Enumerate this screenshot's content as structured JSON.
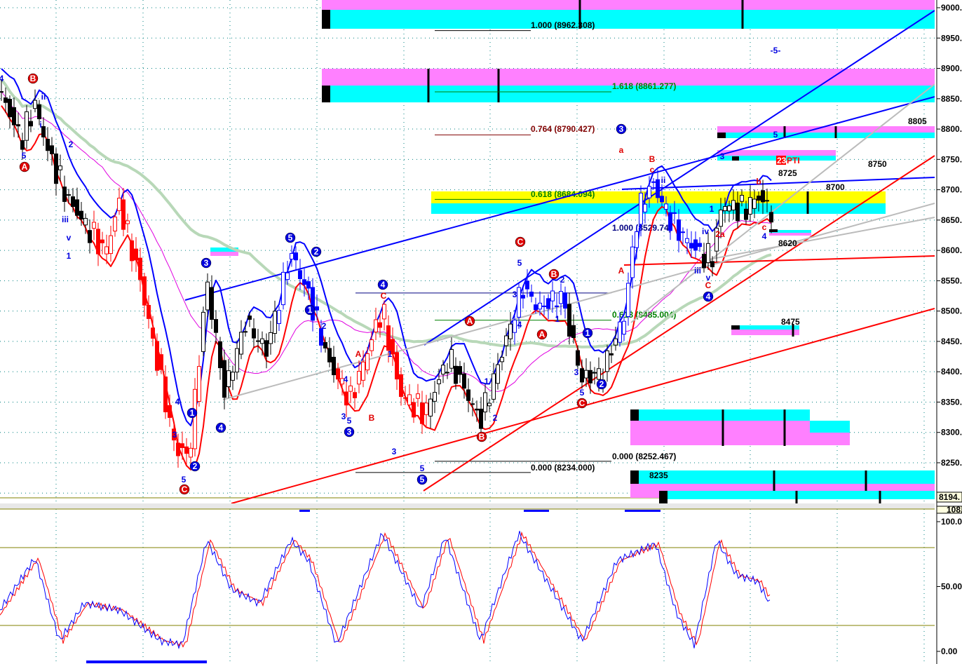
{
  "chart_data": {
    "type": "candlestick",
    "title": "",
    "price_axis": {
      "ticks": [
        "9000.",
        "8950.",
        "8900.",
        "8850.",
        "8800.",
        "8750.",
        "8700.",
        "8650.",
        "8600.",
        "8550.",
        "8500.",
        "8450.",
        "8400.",
        "8350.",
        "8300.",
        "8250."
      ],
      "range": [
        8190,
        9010
      ],
      "last_price_label": "8194."
    },
    "oscillator_axis": {
      "ticks": [
        "100.0",
        "50.00",
        "0.00"
      ],
      "top_label": "108.",
      "range": [
        0,
        100
      ],
      "levels": [
        80,
        20
      ]
    },
    "price_path": [
      [
        0,
        8862
      ],
      [
        30,
        8782
      ],
      [
        50,
        8840
      ],
      [
        70,
        8758
      ],
      [
        100,
        8678
      ],
      [
        150,
        8597
      ],
      [
        170,
        8678
      ],
      [
        200,
        8550
      ],
      [
        250,
        8273
      ],
      [
        270,
        8262
      ],
      [
        295,
        8550
      ],
      [
        320,
        8365
      ],
      [
        350,
        8481
      ],
      [
        380,
        8435
      ],
      [
        415,
        8597
      ],
      [
        440,
        8527
      ],
      [
        470,
        8412
      ],
      [
        500,
        8354
      ],
      [
        545,
        8504
      ],
      [
        570,
        8365
      ],
      [
        605,
        8331
      ],
      [
        640,
        8423
      ],
      [
        685,
        8319
      ],
      [
        720,
        8446
      ],
      [
        745,
        8539
      ],
      [
        770,
        8504
      ],
      [
        800,
        8527
      ],
      [
        830,
        8388
      ],
      [
        860,
        8400
      ],
      [
        890,
        8492
      ],
      [
        910,
        8666
      ],
      [
        930,
        8712
      ],
      [
        960,
        8643
      ],
      [
        995,
        8597
      ],
      [
        1015,
        8585
      ],
      [
        1030,
        8678
      ],
      [
        1060,
        8666
      ],
      [
        1080,
        8689
      ],
      [
        1100,
        8666
      ]
    ],
    "stochastic_path": [
      [
        0,
        32
      ],
      [
        50,
        72
      ],
      [
        85,
        8
      ],
      [
        120,
        37
      ],
      [
        170,
        32
      ],
      [
        230,
        8
      ],
      [
        260,
        5
      ],
      [
        295,
        86
      ],
      [
        330,
        48
      ],
      [
        370,
        37
      ],
      [
        415,
        86
      ],
      [
        440,
        70
      ],
      [
        480,
        5
      ],
      [
        545,
        91
      ],
      [
        600,
        32
      ],
      [
        635,
        89
      ],
      [
        685,
        8
      ],
      [
        740,
        91
      ],
      [
        780,
        54
      ],
      [
        830,
        8
      ],
      [
        880,
        70
      ],
      [
        935,
        83
      ],
      [
        965,
        29
      ],
      [
        990,
        5
      ],
      [
        1022,
        86
      ],
      [
        1050,
        59
      ],
      [
        1080,
        54
      ],
      [
        1100,
        35
      ]
    ],
    "fib_levels": [
      {
        "label": "1.000 (8962.308)",
        "price": 8962.308,
        "color": "#000000"
      },
      {
        "label": "1.618 (8861.277)",
        "price": 8861.277,
        "color": "#008000"
      },
      {
        "label": "0.764 (8790.427)",
        "price": 8790.427,
        "color": "#800000"
      },
      {
        "label": "0.618 (8684.094)",
        "price": 8684.094,
        "color": "#008000"
      },
      {
        "label": "1.000 (8529.74)",
        "price": 8529.74,
        "color": "#000080"
      },
      {
        "label": "0.618 (8485.004)",
        "price": 8485.004,
        "color": "#008000"
      },
      {
        "label": "0.000 (8252.467)",
        "price": 8252.467,
        "color": "#000000"
      },
      {
        "label": "0.000 (8234.000)",
        "price": 8234.0,
        "color": "#000000"
      }
    ],
    "price_notes": [
      "8805",
      "8750",
      "8700",
      "8725",
      "8620",
      "8475",
      "8235"
    ],
    "pti_badge": {
      "num": "23",
      "text": "PTI"
    },
    "wave_labels": [
      {
        "t": "B",
        "c": "#e00000",
        "circ": true
      },
      {
        "t": "A",
        "c": "#e00000",
        "circ": true
      },
      {
        "t": "C",
        "c": "#e00000",
        "circ": true
      },
      {
        "t": "C",
        "c": "#e00000",
        "circ": true
      },
      {
        "t": "A",
        "c": "#e00000",
        "circ": true
      },
      {
        "t": "A",
        "c": "#e00000",
        "circ": true
      },
      {
        "t": "B",
        "c": "#e00000",
        "circ": true
      },
      {
        "t": "B",
        "c": "#e00000",
        "circ": true
      },
      {
        "t": "C",
        "c": "#e00000",
        "circ": true
      },
      {
        "t": "1",
        "c": "#0000e0",
        "circ": true
      },
      {
        "t": "2",
        "c": "#0000e0",
        "circ": true
      },
      {
        "t": "3",
        "c": "#0000e0",
        "circ": true
      },
      {
        "t": "4",
        "c": "#0000e0",
        "circ": true
      },
      {
        "t": "5",
        "c": "#0000e0",
        "circ": true
      },
      {
        "t": "2",
        "c": "#0000e0",
        "circ": true
      },
      {
        "t": "1",
        "c": "#0000e0",
        "circ": true
      },
      {
        "t": "3",
        "c": "#0000e0",
        "circ": true
      },
      {
        "t": "4",
        "c": "#0000e0",
        "circ": true
      },
      {
        "t": "5",
        "c": "#0000e0",
        "circ": true
      },
      {
        "t": "1",
        "c": "#0000e0",
        "circ": true
      },
      {
        "t": "2",
        "c": "#0000e0",
        "circ": true
      },
      {
        "t": "3",
        "c": "#0000e0",
        "circ": true
      },
      {
        "t": "4",
        "c": "#0000e0",
        "circ": true
      },
      {
        "t": "4",
        "c": "#0000e0"
      },
      {
        "t": "ii",
        "c": "#0000e0"
      },
      {
        "t": "i",
        "c": "#0000e0"
      },
      {
        "t": "5",
        "c": "#0000e0"
      },
      {
        "t": "2",
        "c": "#0000e0"
      },
      {
        "t": "iii",
        "c": "#0000e0"
      },
      {
        "t": "v",
        "c": "#0000e0"
      },
      {
        "t": "1",
        "c": "#0000e0"
      },
      {
        "t": "4",
        "c": "#0000e0"
      },
      {
        "t": "3",
        "c": "#0000e0"
      },
      {
        "t": "5",
        "c": "#0000e0"
      },
      {
        "t": "2",
        "c": "#0000e0"
      },
      {
        "t": "1",
        "c": "#0000e0"
      },
      {
        "t": "4",
        "c": "#0000e0"
      },
      {
        "t": "3",
        "c": "#0000e0"
      },
      {
        "t": "5",
        "c": "#0000e0"
      },
      {
        "t": "1",
        "c": "#0000e0"
      },
      {
        "t": "3",
        "c": "#0000e0"
      },
      {
        "t": "5",
        "c": "#0000e0"
      },
      {
        "t": "1",
        "c": "#0000e0"
      },
      {
        "t": "2",
        "c": "#0000e0"
      },
      {
        "t": "5",
        "c": "#0000e0"
      },
      {
        "t": "3",
        "c": "#0000e0"
      },
      {
        "t": "4",
        "c": "#0000e0"
      },
      {
        "t": "2",
        "c": "#0000e0"
      },
      {
        "t": "1",
        "c": "#0000e0"
      },
      {
        "t": "3",
        "c": "#0000e0"
      },
      {
        "t": "5",
        "c": "#0000e0"
      },
      {
        "t": "iii",
        "c": "#0000e0"
      },
      {
        "t": "v",
        "c": "#0000e0"
      },
      {
        "t": "iv",
        "c": "#0000e0"
      },
      {
        "t": "1",
        "c": "#0000e0"
      },
      {
        "t": "ii",
        "c": "#0000e0"
      },
      {
        "t": "3",
        "c": "#0000e0"
      },
      {
        "t": "-5-",
        "c": "#0000e0"
      },
      {
        "t": "5",
        "c": "#0000e0"
      },
      {
        "t": "4",
        "c": "#0000e0"
      },
      {
        "t": "a",
        "c": "#e00000"
      },
      {
        "t": "B",
        "c": "#e00000"
      },
      {
        "t": "c",
        "c": "#e00000"
      },
      {
        "t": "A",
        "c": "#e00000"
      },
      {
        "t": "C",
        "c": "#e00000"
      },
      {
        "t": "A",
        "c": "#e00000"
      },
      {
        "t": "B",
        "c": "#e00000"
      },
      {
        "t": "C",
        "c": "#e00000"
      },
      {
        "t": "c",
        "c": "#e00000"
      },
      {
        "t": "b",
        "c": "#e00000"
      },
      {
        "t": "2a",
        "c": "#e00000"
      }
    ],
    "colors": {
      "cyan": "#00ffff",
      "magenta": "#ff80ff",
      "yellow": "#ffff00",
      "blue": "#0000ff",
      "red": "#ff0000",
      "ma_green": "#b8d8b8",
      "ma_magenta": "#e000e0",
      "gray": "#bbbbbb"
    }
  }
}
